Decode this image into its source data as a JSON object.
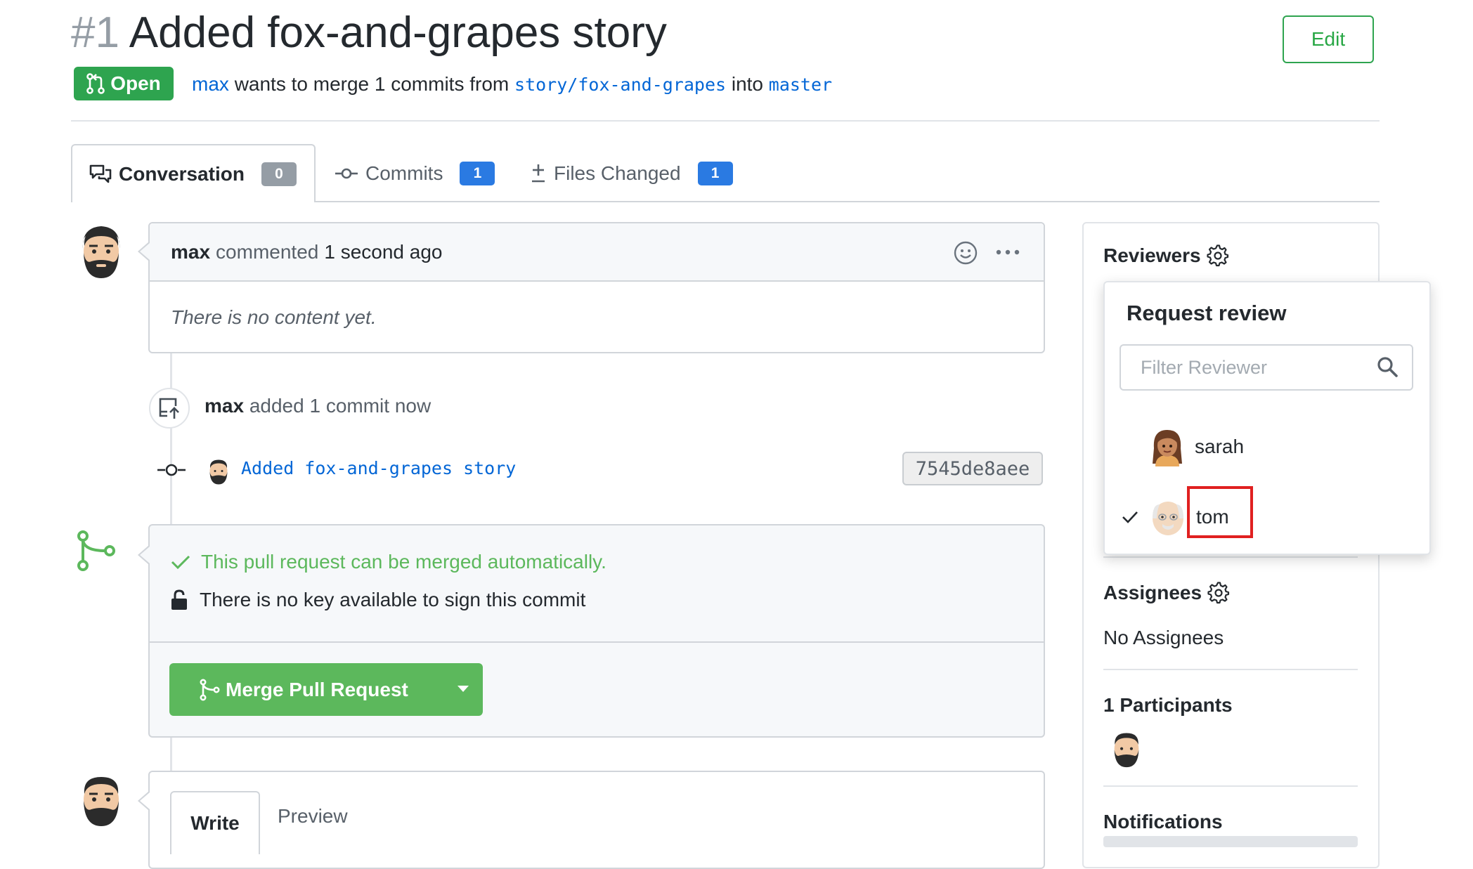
{
  "header": {
    "pr_number": "#1",
    "title": "Added fox-and-grapes story",
    "edit_label": "Edit",
    "state": "Open",
    "author": "max",
    "merge_text_1": "wants to merge 1 commits from",
    "source_branch": "story/fox-and-grapes",
    "merge_text_2": "into",
    "target_branch": "master"
  },
  "tabs": [
    {
      "label": "Conversation",
      "count": "0"
    },
    {
      "label": "Commits",
      "count": "1"
    },
    {
      "label": "Files Changed",
      "count": "1"
    }
  ],
  "timeline": {
    "comment": {
      "author": "max",
      "action": "commented",
      "time": "1 second ago",
      "body": "There is no content yet."
    },
    "commit_event": {
      "author": "max",
      "text": "added 1 commit now"
    },
    "commit": {
      "message": "Added fox-and-grapes story",
      "sha": "7545de8aee"
    },
    "merge": {
      "status": "This pull request can be merged automatically.",
      "key_notice": "There is no key available to sign this commit",
      "button_label": "Merge Pull Request"
    },
    "editor": {
      "write_tab": "Write",
      "preview_tab": "Preview"
    }
  },
  "sidebar": {
    "reviewers_title": "Reviewers",
    "assignees_title": "Assignees",
    "assignees_value": "No Assignees",
    "participants_title": "1 Participants",
    "notifications_title": "Notifications"
  },
  "review_popover": {
    "title": "Request review",
    "filter_placeholder": "Filter Reviewer",
    "reviewers": [
      {
        "name": "sarah",
        "selected": false
      },
      {
        "name": "tom",
        "selected": true
      }
    ]
  },
  "colors": {
    "green": "#2ea44f",
    "merge_green": "#5cb85c",
    "link_blue": "#0366d6",
    "badge_blue": "#2a7ae2",
    "highlight_red": "#e02020"
  }
}
